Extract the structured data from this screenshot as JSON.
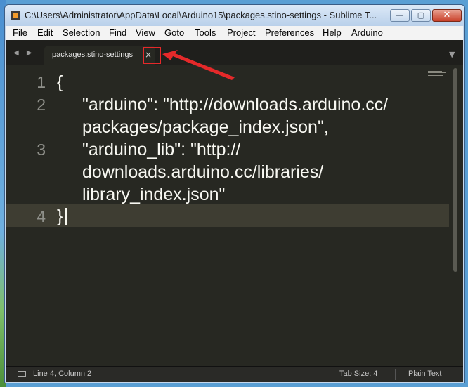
{
  "window": {
    "title": "C:\\Users\\Administrator\\AppData\\Local\\Arduino15\\packages.stino-settings - Sublime T...",
    "minimize_label": "—",
    "maximize_label": "▢",
    "close_label": "✕"
  },
  "menu": {
    "items": [
      "File",
      "Edit",
      "Selection",
      "Find",
      "View",
      "Goto",
      "Tools",
      "Project",
      "Preferences",
      "Help",
      "Arduino"
    ]
  },
  "tabs": [
    {
      "label": "packages.stino-settings",
      "close": "×",
      "active": true
    }
  ],
  "editor": {
    "line_numbers": [
      "1",
      "2",
      "3",
      "4"
    ],
    "lines": [
      "{",
      "\"arduino\": \"http://downloads.arduino.cc/",
      "packages/package_index.json\",",
      "\"arduino_lib\": \"http://",
      "downloads.arduino.cc/libraries/",
      "library_index.json\"",
      "}"
    ],
    "current_line": 4
  },
  "status": {
    "position": "Line 4, Column 2",
    "tab_size": "Tab Size: 4",
    "syntax": "Plain Text"
  },
  "icons": {
    "app": "sublime-text-icon",
    "nav": "tab-nav-arrows-icon",
    "dropdown": "tab-list-dropdown-icon",
    "status": "panel-toggle-icon"
  },
  "colors": {
    "editor_bg": "#272822",
    "current_line_bg": "#3e3d32",
    "text": "#f8f8f2",
    "annotation_red": "#e5292a"
  }
}
